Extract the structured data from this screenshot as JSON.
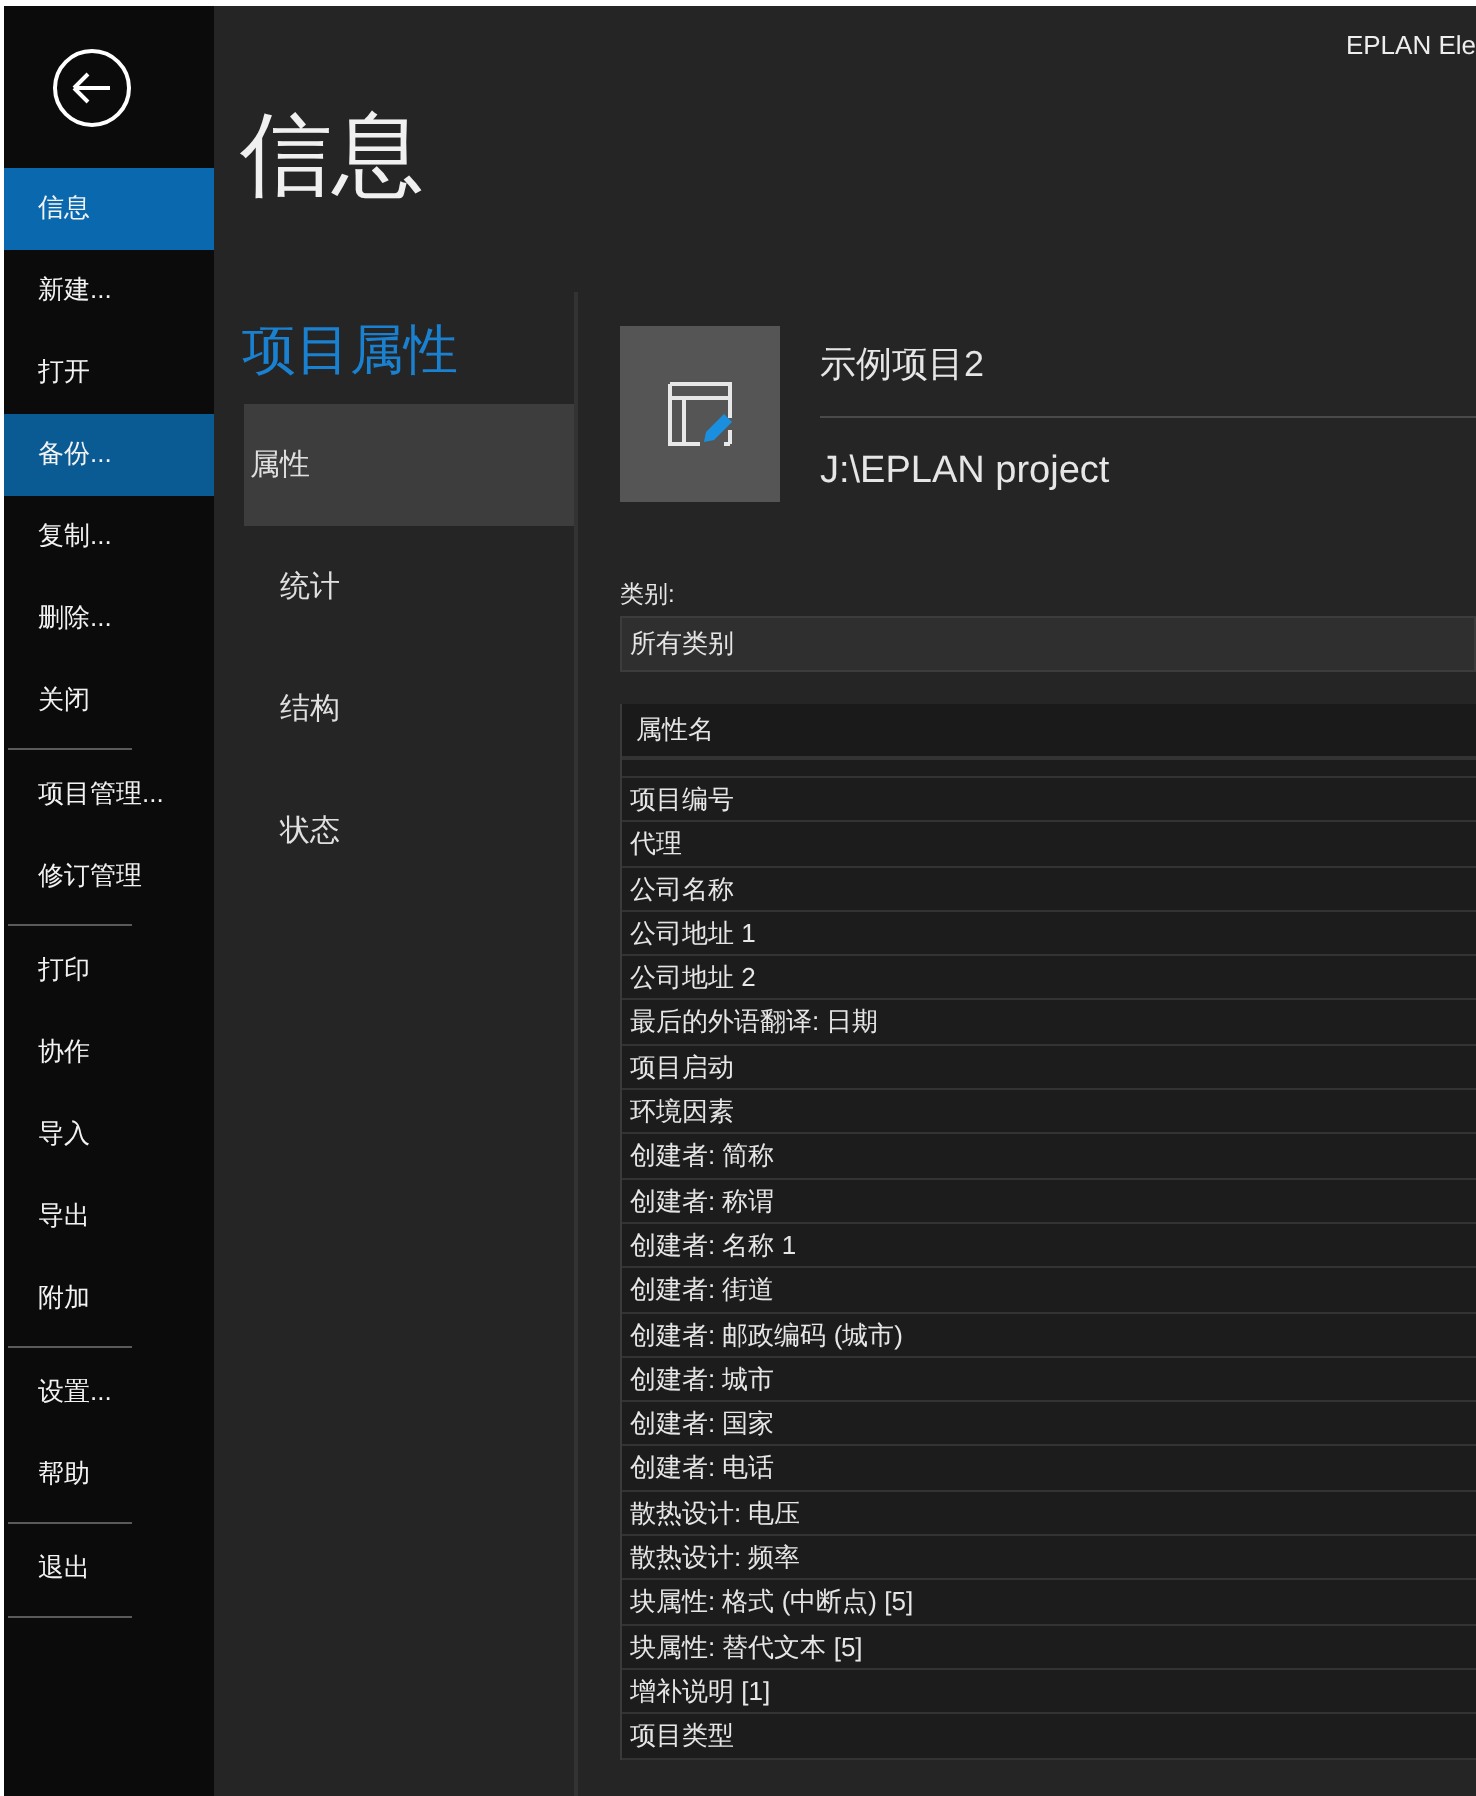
{
  "window": {
    "title": "EPLAN Ele"
  },
  "sidebar": {
    "groups": [
      [
        {
          "label": "信息",
          "selected": true,
          "hovered": false
        },
        {
          "label": "新建...",
          "selected": false,
          "hovered": false
        },
        {
          "label": "打开",
          "selected": false,
          "hovered": false
        },
        {
          "label": "备份...",
          "selected": false,
          "hovered": true
        },
        {
          "label": "复制...",
          "selected": false,
          "hovered": false
        },
        {
          "label": "删除...",
          "selected": false,
          "hovered": false
        },
        {
          "label": "关闭",
          "selected": false,
          "hovered": false
        }
      ],
      [
        {
          "label": "项目管理...",
          "selected": false,
          "hovered": false
        },
        {
          "label": "修订管理",
          "selected": false,
          "hovered": false
        }
      ],
      [
        {
          "label": "打印",
          "selected": false,
          "hovered": false
        },
        {
          "label": "协作",
          "selected": false,
          "hovered": false
        },
        {
          "label": "导入",
          "selected": false,
          "hovered": false
        },
        {
          "label": "导出",
          "selected": false,
          "hovered": false
        },
        {
          "label": "附加",
          "selected": false,
          "hovered": false
        }
      ],
      [
        {
          "label": "设置...",
          "selected": false,
          "hovered": false
        },
        {
          "label": "帮助",
          "selected": false,
          "hovered": false
        }
      ],
      [
        {
          "label": "退出",
          "selected": false,
          "hovered": false
        }
      ]
    ]
  },
  "page_title": "信息",
  "section_title": "项目属性",
  "nav": [
    {
      "label": "属性",
      "selected": true
    },
    {
      "label": "统计",
      "selected": false
    },
    {
      "label": "结构",
      "selected": false
    },
    {
      "label": "状态",
      "selected": false
    }
  ],
  "project": {
    "name": "示例项目2",
    "path": "J:\\EPLAN project"
  },
  "category": {
    "label": "类别:",
    "value": "所有类别"
  },
  "table": {
    "columns": [
      "属性名"
    ],
    "rows": [
      "项目编号",
      "代理",
      "公司名称",
      "公司地址 1",
      "公司地址 2",
      "最后的外语翻译: 日期",
      "项目启动",
      "环境因素",
      "创建者: 简称",
      "创建者: 称谓",
      "创建者: 名称 1",
      "创建者: 街道",
      "创建者: 邮政编码 (城市)",
      "创建者: 城市",
      "创建者: 国家",
      "创建者: 电话",
      "散热设计: 电压",
      "散热设计: 频率",
      "块属性: 格式 (中断点) [5]",
      "块属性: 替代文本 [5]",
      "增补说明 [1]",
      "项目类型"
    ]
  }
}
